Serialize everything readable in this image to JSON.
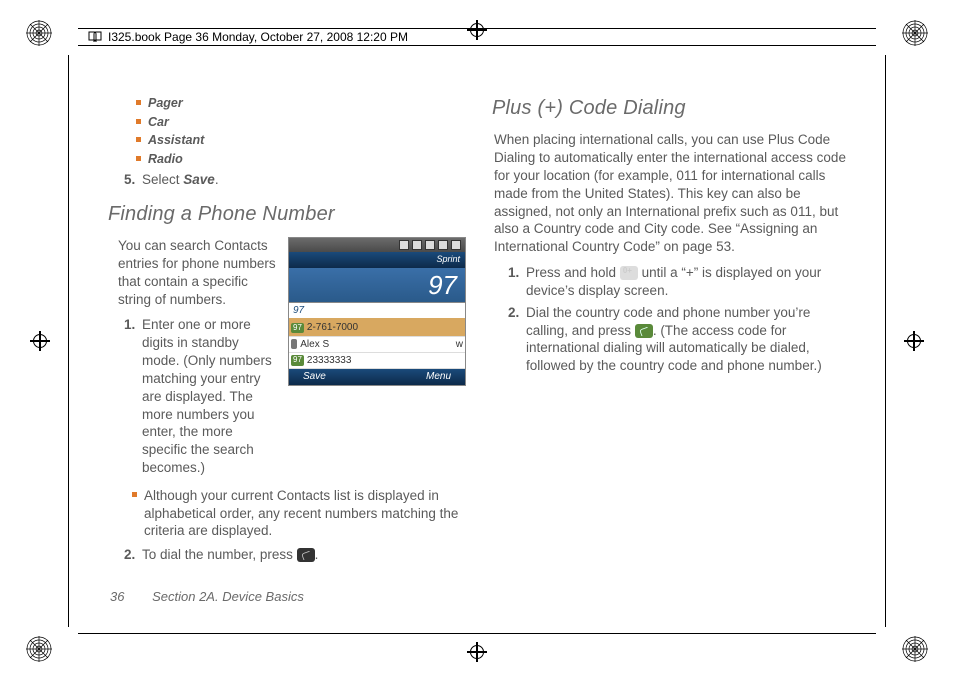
{
  "header": {
    "running": "I325.book  Page 36  Monday, October 27, 2008  12:20 PM"
  },
  "left": {
    "bullets": [
      "Pager",
      "Car",
      "Assistant",
      "Radio"
    ],
    "step5_pre": "Select ",
    "step5_bold": "Save",
    "step5_post": ".",
    "heading": "Finding a Phone Number",
    "intro": "You can search Contacts entries for phone numbers that contain a specific string of numbers.",
    "step1": "Enter one or more digits in standby mode. (Only numbers matching your entry are displayed. The more numbers you enter, the more specific the search becomes.)",
    "sub1": "Although your current Contacts list is displayed in alphabetical order, any recent numbers matching the criteria are displayed.",
    "step2_pre": "To dial the number, press ",
    "step2_post": "."
  },
  "phone": {
    "carrier": "Sprint",
    "big": "97",
    "smallLabel": "97",
    "row1_num": "2-761-7000",
    "row2_name": "Alex S",
    "row2_suffix": "w",
    "row3_num": "23333333",
    "softLeft": "Save",
    "softRight": "Menu",
    "rowTag": "97"
  },
  "right": {
    "heading": "Plus (+) Code Dialing",
    "para": "When placing international calls, you can use Plus Code Dialing to automatically enter the international access code for your location (for example, 011 for international calls made from the United States). This key can also be assigned, not only an International prefix such as 011, but also a Country code and City code. See “Assigning an International Country Code” on page 53.",
    "step1_pre": "Press and hold ",
    "step1_post": " until a “+” is displayed on your device’s display screen.",
    "step2_pre": "Dial the country code and phone number you’re calling, and press ",
    "step2_post": ". (The access code for international dialing will automatically be dialed, followed by the country code and phone number.)"
  },
  "footer": {
    "pageNum": "36",
    "section": "Section 2A. Device Basics"
  }
}
